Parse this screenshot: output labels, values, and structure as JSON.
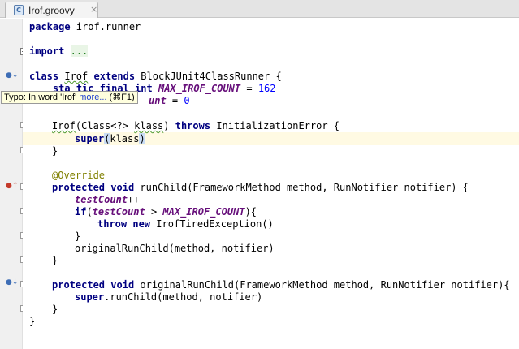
{
  "tab": {
    "title": "Irof.groovy",
    "icon": "groovy-file-icon",
    "close": "×"
  },
  "tooltip": {
    "prefix": "Typo: In word 'Irof'",
    "link": "more...",
    "shortcut": "(⌘F1)"
  },
  "code": {
    "l1": {
      "kw": "package",
      "rest": " irof.runner"
    },
    "l2": {
      "kw": "import",
      "fold": "..."
    },
    "l3": {
      "kw1": "class",
      "cls": "Irof",
      "kw2": "extends",
      "rest": " BlockJUnit4ClassRunner {"
    },
    "l4": {
      "pre": "    sta",
      "hidden": "tic final int",
      "const": "MAX_IROF_COUNT",
      "eq": " = ",
      "num": "162"
    },
    "l5": {
      "field": "unt",
      "eq": " = ",
      "num": "0"
    },
    "l6": {
      "ctor": "Irof",
      "rest": "(Class<?> ",
      "param": "klass",
      "rest2": ") ",
      "kw": "throws",
      "rest3": " InitializationError {"
    },
    "l7": {
      "kw": "super",
      "open": "(",
      "arg": "klass",
      "close": ")"
    },
    "l8": {
      "text": "}"
    },
    "l9": {
      "ann": "@Override"
    },
    "l10": {
      "kw1": "protected",
      "kw2": "void",
      "rest": " runChild(FrameworkMethod method, RunNotifier notifier) {"
    },
    "l11": {
      "field": "testCount",
      "rest": "++"
    },
    "l12": {
      "kw": "if",
      "open": "(",
      "field": "testCount",
      "gt": " > ",
      "const": "MAX_IROF_COUNT",
      "close": "){"
    },
    "l13": {
      "kw1": "throw",
      "kw2": "new",
      "rest": " IrofTiredException()"
    },
    "l14": {
      "text": "}"
    },
    "l15": {
      "text": "originalRunChild(method, notifier)"
    },
    "l16": {
      "text": "}"
    },
    "l17": {
      "kw1": "protected",
      "kw2": "void",
      "rest": " originalRunChild(FrameworkMethod method, RunNotifier notifier){"
    },
    "l18": {
      "kw": "super",
      "rest": ".runChild(method, notifier)"
    },
    "l19": {
      "text": "}"
    },
    "l20": {
      "text": "}"
    }
  },
  "colors": {
    "keyword": "#000080",
    "number": "#0000ff",
    "field": "#660e7a",
    "annotation": "#808000",
    "current_line": "#fffae3"
  }
}
